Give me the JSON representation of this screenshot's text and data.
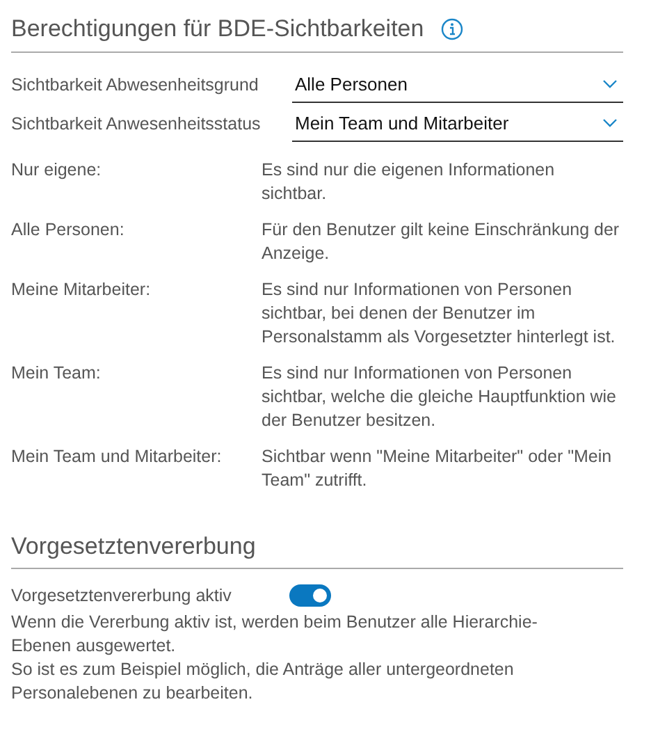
{
  "section_1": {
    "title": "Berechtigungen für BDE-Sichtbarkeiten",
    "selects": [
      {
        "label": "Sichtbarkeit Abwesenheitsgrund",
        "value": "Alle Personen"
      },
      {
        "label": "Sichtbarkeit Anwesenheitsstatus",
        "value": "Mein Team und Mitarbeiter"
      }
    ],
    "definitions": [
      {
        "term": "Nur eigene:",
        "description": "Es sind nur die eigenen Informationen sichtbar."
      },
      {
        "term": "Alle Personen:",
        "description": "Für den Benutzer gilt keine Einschränkung der Anzeige."
      },
      {
        "term": "Meine Mitarbeiter:",
        "description": "Es sind nur Informationen von Personen sichtbar, bei denen der Benutzer im Personalstamm als Vorgesetzter hinterlegt ist."
      },
      {
        "term": "Mein Team:",
        "description": "Es sind nur Informationen von Personen sichtbar, welche die gleiche Hauptfunktion wie der Benutzer besitzen."
      },
      {
        "term": "Mein Team und Mitarbeiter:",
        "description": "Sichtbar wenn \"Meine Mitarbeiter\" oder \"Mein Team\" zutrifft."
      }
    ]
  },
  "section_2": {
    "title": "Vorgesetztenvererbung",
    "toggle": {
      "label": "Vorgesetztenvererbung aktiv",
      "on": true
    },
    "paragraphs": [
      "Wenn die Vererbung aktiv ist, werden beim Benutzer alle Hierarchie-Ebenen ausgewertet.",
      "So ist es zum Beispiel möglich, die Anträge aller untergeordneten Personalebenen zu bearbeiten."
    ]
  }
}
